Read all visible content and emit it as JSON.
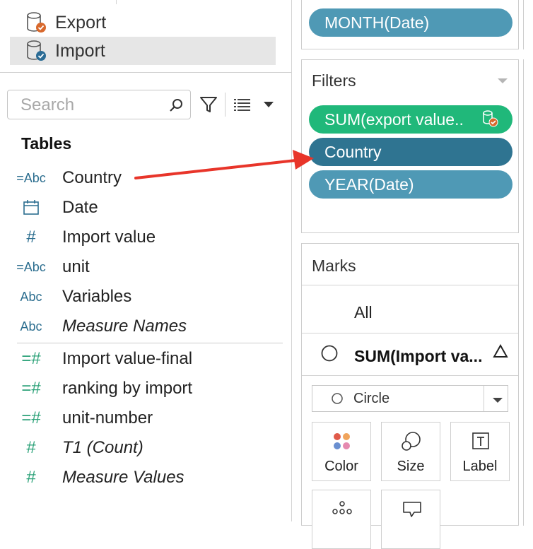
{
  "datasources": [
    {
      "label": "Export",
      "selected": false,
      "badge": "orange"
    },
    {
      "label": "Import",
      "selected": true,
      "badge": "blue"
    }
  ],
  "search": {
    "placeholder": "Search"
  },
  "tables_header": "Tables",
  "fields": [
    {
      "icon": "=Abc",
      "label": "Country",
      "italic": false,
      "green": false
    },
    {
      "icon": "calendar",
      "label": "Date",
      "italic": false,
      "green": false
    },
    {
      "icon": "#",
      "label": "Import value",
      "italic": false,
      "green": false
    },
    {
      "icon": "=Abc",
      "label": "unit",
      "italic": false,
      "green": false
    },
    {
      "icon": "Abc",
      "label": "Variables",
      "italic": false,
      "green": false
    },
    {
      "icon": "Abc",
      "label": "Measure Names",
      "italic": true,
      "green": false
    },
    {
      "icon": "=#",
      "label": "Import value-final",
      "italic": false,
      "green": true
    },
    {
      "icon": "=#",
      "label": "ranking by import",
      "italic": false,
      "green": true
    },
    {
      "icon": "=#",
      "label": "unit-number",
      "italic": false,
      "green": true
    },
    {
      "icon": "#",
      "label": "T1 (Count)",
      "italic": true,
      "green": true
    },
    {
      "icon": "#",
      "label": "Measure Values",
      "italic": true,
      "green": true
    }
  ],
  "columns_pill": "MONTH(Date)",
  "filters": {
    "title": "Filters",
    "pills": [
      {
        "label": "SUM(export value..",
        "style": "green"
      },
      {
        "label": "Country",
        "style": "dark"
      },
      {
        "label": "YEAR(Date)",
        "style": "blue"
      }
    ]
  },
  "marks": {
    "title": "Marks",
    "all_label": "All",
    "measure_label": "SUM(Import va...",
    "mark_type": "Circle",
    "buttons": [
      "Color",
      "Size",
      "Label"
    ]
  },
  "colors": {
    "pill_blue": "#4f99b5",
    "pill_dark": "#2f7491",
    "pill_green": "#20b87a",
    "arrow": "#e8352a"
  }
}
